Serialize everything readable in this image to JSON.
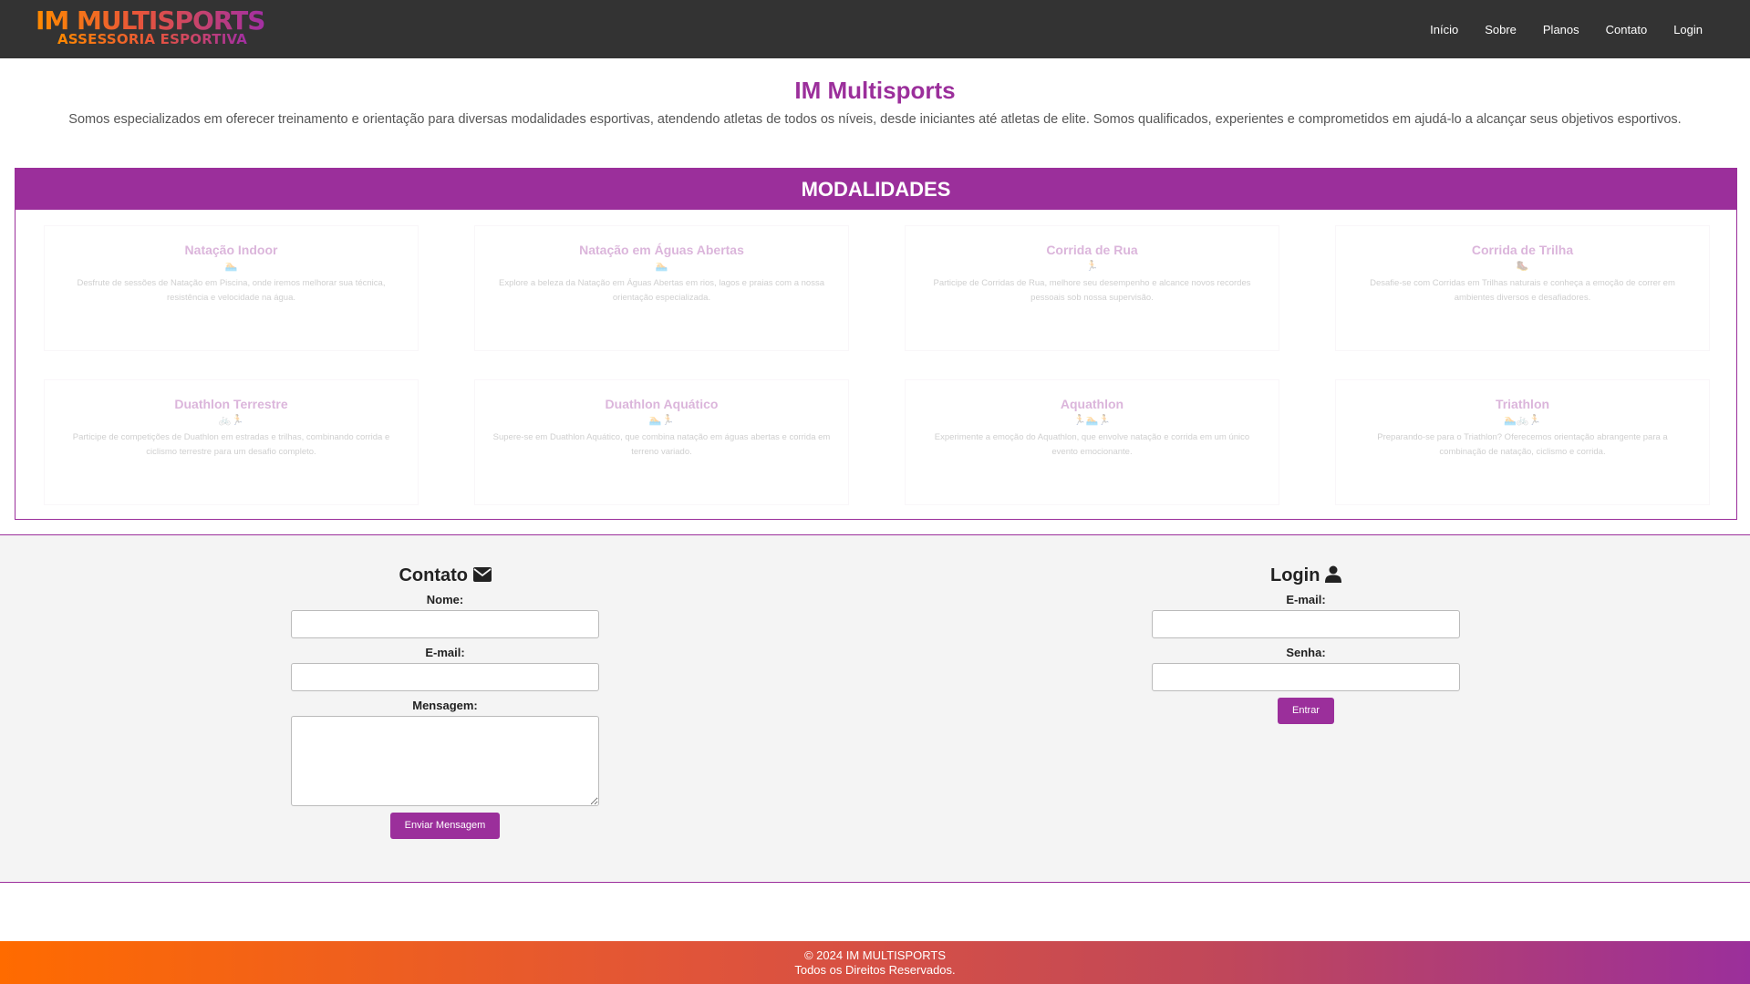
{
  "header": {
    "logo_line1": "IM MULTISPORTS",
    "logo_line2": "ASSESSORIA ESPORTIVA",
    "nav": [
      "Início",
      "Sobre",
      "Planos",
      "Contato",
      "Login"
    ]
  },
  "intro": {
    "title": "IM Multisports",
    "text": "Somos especializados em oferecer treinamento e orientação para diversas modalidades esportivas, atendendo atletas de todos os níveis, desde iniciantes até atletas de elite. Somos qualificados, experientes e comprometidos em ajudá-lo a alcançar seus objetivos esportivos."
  },
  "modalidades": {
    "heading": "MODALIDADES",
    "cards": [
      {
        "title": "Natação Indoor",
        "icons": "swimmer-icon",
        "glyphs": "🏊",
        "desc": "Desfrute de sessões de Natação em Piscina, onde iremos melhorar sua técnica, resistência e velocidade na água."
      },
      {
        "title": "Natação em Águas Abertas",
        "icons": "swimmer-icon",
        "glyphs": "🏊",
        "desc": "Explore a beleza da Natação em Águas Abertas em rios, lagos e praias com a nossa orientação especializada."
      },
      {
        "title": "Corrida de Rua",
        "icons": "runner-icon",
        "glyphs": "🏃",
        "desc": "Participe de Corridas de Rua, melhore seu desempenho e alcance novos recordes pessoais sob nossa supervisão."
      },
      {
        "title": "Corrida de Trilha",
        "icons": "hiker-icon",
        "glyphs": "🥾",
        "desc": "Desafie-se com Corridas em Trilhas naturais e conheça a emoção de correr em ambientes diversos e desafiadores."
      },
      {
        "title": "Duathlon Terrestre",
        "icons": "bike-runner-icon",
        "glyphs": "🚲🏃",
        "desc": "Participe de competições de Duathlon em estradas e trilhas, combinando corrida e ciclismo terrestre para um desafio completo."
      },
      {
        "title": "Duathlon Aquático",
        "icons": "swimmer-runner-icon",
        "glyphs": "🏊🏃",
        "desc": "Supere-se em Duathlon Aquático, que combina natação em águas abertas e corrida em terreno variado."
      },
      {
        "title": "Aquathlon",
        "icons": "runner-swimmer-runner-icon",
        "glyphs": "🏃🏊🏃",
        "desc": "Experimente a emoção do Aquathlon, que envolve natação e corrida em um único evento emocionante."
      },
      {
        "title": "Triathlon",
        "icons": "swimmer-bike-runner-icon",
        "glyphs": "🏊🚲🏃",
        "desc": "Preparando-se para o Triathlon? Oferecemos orientação abrangente para a combinação de natação, ciclismo e corrida."
      }
    ]
  },
  "contato": {
    "title": "Contato",
    "icon": "envelope-icon",
    "name_label": "Nome:",
    "email_label": "E-mail:",
    "message_label": "Mensagem:",
    "submit": "Enviar Mensagem"
  },
  "login": {
    "title": "Login",
    "icon": "user-icon",
    "email_label": "E-mail:",
    "password_label": "Senha:",
    "submit": "Entrar"
  },
  "footer": {
    "line1": "© 2024 IM MULTISPORTS",
    "line2": "Todos os Direitos Reservados."
  },
  "colors": {
    "accent": "#9b2f9b",
    "header_bg": "#333333",
    "footer_start": "#ff6b00",
    "footer_end": "#9b2f9b"
  }
}
